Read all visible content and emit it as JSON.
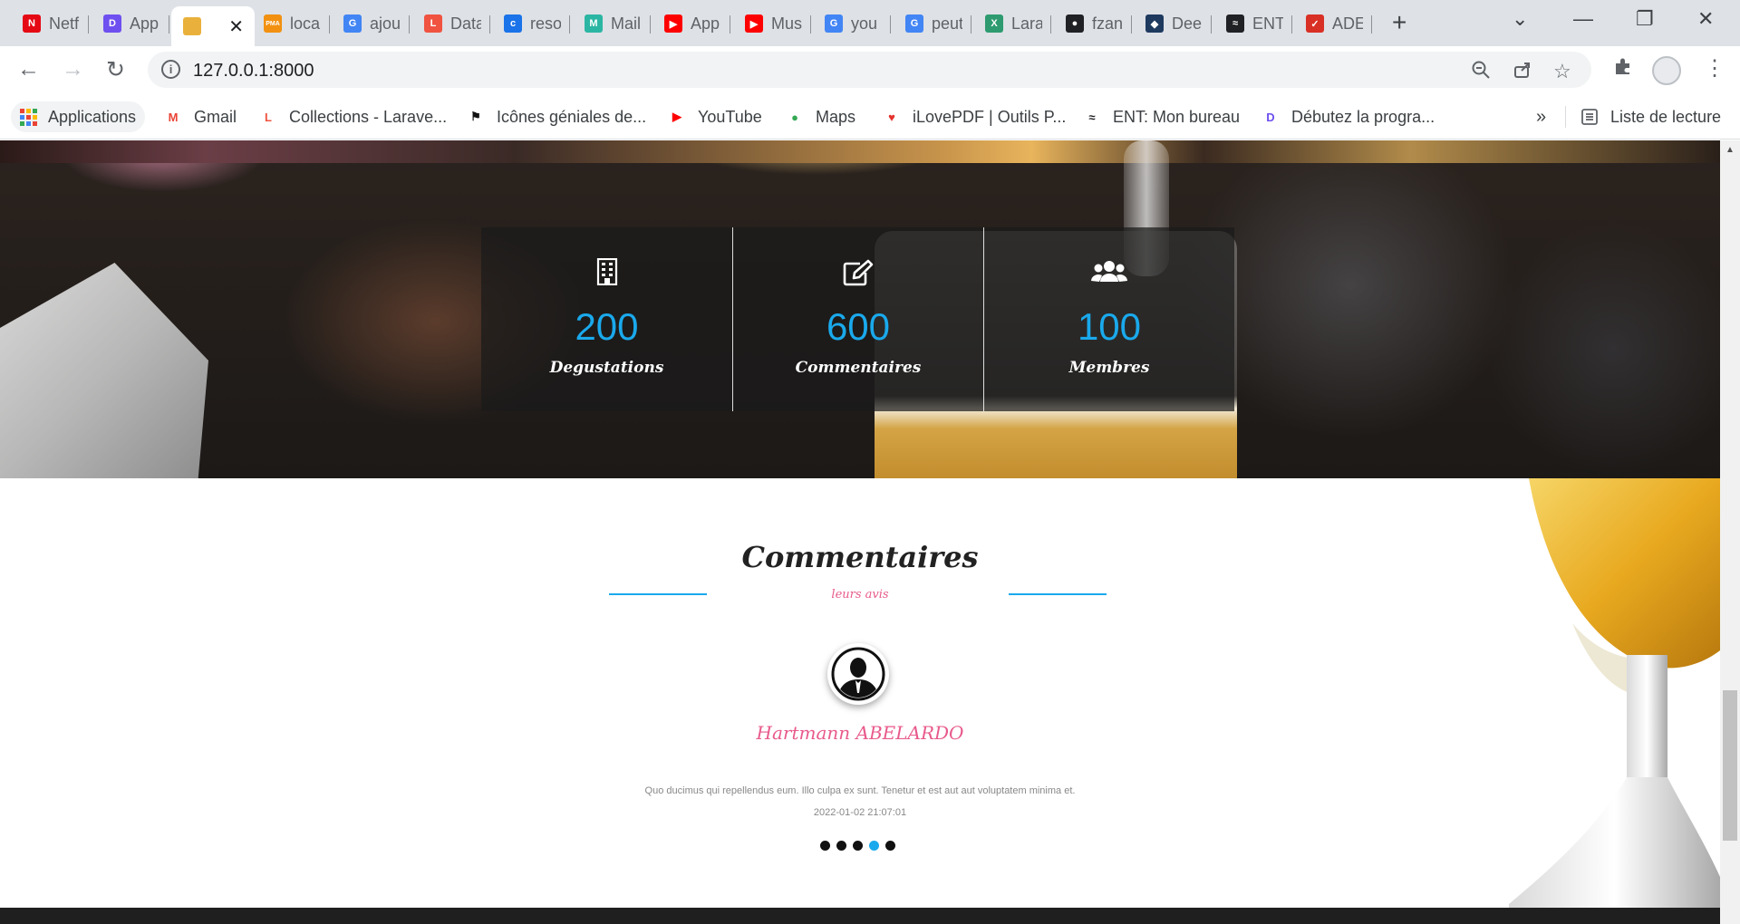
{
  "browser": {
    "tabs": [
      {
        "title": "Netflix",
        "favicon_text": "N",
        "color": "#e50914"
      },
      {
        "title": "App",
        "favicon_text": "D",
        "color": "#6e4ff0"
      },
      {
        "title": "",
        "favicon_text": "",
        "color": "#e9b13b",
        "active": true
      },
      {
        "title": "localhost",
        "favicon_text": "PMA",
        "color": "#f29111"
      },
      {
        "title": "ajouter",
        "favicon_text": "G",
        "color": "#4285f4"
      },
      {
        "title": "Database",
        "favicon_text": "L",
        "color": "#f05340"
      },
      {
        "title": "resource",
        "favicon_text": "c",
        "color": "#1a73e8"
      },
      {
        "title": "Mail",
        "favicon_text": "M",
        "color": "#2bb6a3"
      },
      {
        "title": "App",
        "favicon_text": "▶",
        "color": "#ff0000"
      },
      {
        "title": "Music",
        "favicon_text": "▶",
        "color": "#ff0000"
      },
      {
        "title": "you",
        "favicon_text": "G",
        "color": "#4285f4"
      },
      {
        "title": "peut",
        "favicon_text": "G",
        "color": "#4285f4"
      },
      {
        "title": "Laravel",
        "favicon_text": "X",
        "color": "#2d9b6f"
      },
      {
        "title": "fzan",
        "favicon_text": "●",
        "color": "#202124"
      },
      {
        "title": "Deep",
        "favicon_text": "◆",
        "color": "#1e3a5f"
      },
      {
        "title": "ENT",
        "favicon_text": "≈",
        "color": "#202124"
      },
      {
        "title": "ADE",
        "favicon_text": "✓",
        "color": "#d93025"
      }
    ],
    "window_controls": {
      "tab_search": "⌄",
      "minimize": "—",
      "restore": "❐",
      "close": "✕"
    },
    "url": "127.0.0.1:8000",
    "bookmarks": [
      {
        "label": "Applications",
        "icon": "apps-grid-icon"
      },
      {
        "label": "Gmail",
        "icon": "gmail-icon",
        "favicon_text": "M",
        "color": "#ea4335"
      },
      {
        "label": "Collections - Larave...",
        "icon": "laravel-icon",
        "favicon_text": "L",
        "color": "#f05340"
      },
      {
        "label": "Icônes géniales de...",
        "icon": "fontawesome-icon",
        "favicon_text": "⚑",
        "color": "#111111"
      },
      {
        "label": "YouTube",
        "icon": "youtube-icon",
        "favicon_text": "▶",
        "color": "#ff0000"
      },
      {
        "label": "Maps",
        "icon": "maps-icon",
        "favicon_text": "●",
        "color": "#34a853"
      },
      {
        "label": "iLovePDF | Outils P...",
        "icon": "ilovepdf-icon",
        "favicon_text": "♥",
        "color": "#e5322d"
      },
      {
        "label": "ENT: Mon bureau",
        "icon": "ent-icon",
        "favicon_text": "≈",
        "color": "#202124"
      },
      {
        "label": "Débutez la progra...",
        "icon": "openclassrooms-icon",
        "favicon_text": "D",
        "color": "#6e4ff0"
      }
    ],
    "bookmarks_more": "»",
    "reading_list": "Liste de lecture"
  },
  "stats": [
    {
      "icon": "building-icon",
      "value": "200",
      "label": "Degustations"
    },
    {
      "icon": "edit-icon",
      "value": "600",
      "label": "Commentaires"
    },
    {
      "icon": "users-icon",
      "value": "100",
      "label": "Membres"
    }
  ],
  "comments": {
    "title": "Commentaires",
    "subtitle": "leurs avis",
    "review": {
      "name": "Hartmann ABELARDO",
      "text": "Quo ducimus qui repellendus eum. Illo culpa ex sunt. Tenetur et est aut aut voluptatem minima et.",
      "date": "2022-01-02 21:07:01"
    },
    "carousel_active_index": 3,
    "carousel_count": 5
  },
  "colors": {
    "accent": "#1aa9ec",
    "pink": "#e85a8c"
  }
}
